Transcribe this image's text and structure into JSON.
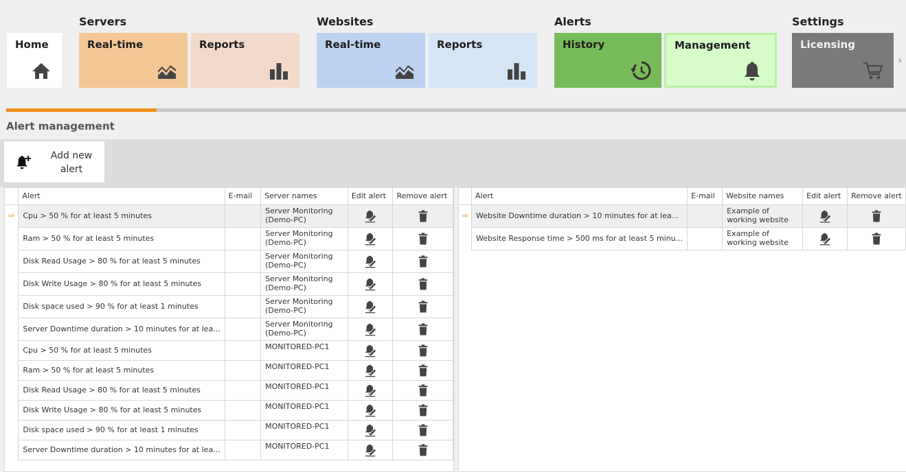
{
  "ribbon": {
    "groups": {
      "servers": "Servers",
      "websites": "Websites",
      "alerts": "Alerts",
      "settings": "Settings"
    },
    "tiles": {
      "home": "Home",
      "servers_realtime": "Real-time",
      "servers_reports": "Reports",
      "websites_realtime": "Real-time",
      "websites_reports": "Reports",
      "alerts_history": "History",
      "alerts_management": "Management",
      "settings_licensing": "Licensing"
    },
    "icons": {
      "home": "home-icon",
      "realtime": "realtime-chart-icon",
      "reports": "bar-chart-icon",
      "history": "history-icon",
      "management": "bell-icon",
      "licensing": "cart-icon"
    },
    "scroll_glyph": "›",
    "colors": {
      "servers_realtime": "#f3c896",
      "servers_reports": "#f2d9c9",
      "websites_realtime": "#bcd2f2",
      "websites_reports": "#d6e5f6",
      "history": "#78bb5a",
      "management": "#d6fcc8",
      "licensing": "#7a7a7a",
      "accent": "#ef8f1a"
    }
  },
  "page": {
    "title": "Alert management",
    "add_button": "Add new alert",
    "row_indicator": "⇨"
  },
  "server_grid": {
    "columns": [
      "Alert",
      "E-mail",
      "Server names",
      "Edit alert",
      "Remove alert"
    ],
    "rows": [
      {
        "alert": "Cpu > 50 % for at least 5 minutes",
        "email": "",
        "server": "Server Monitoring (Demo-PC)"
      },
      {
        "alert": "Ram > 50 % for at least 5 minutes",
        "email": "",
        "server": "Server Monitoring (Demo-PC)"
      },
      {
        "alert": "Disk Read Usage > 80 % for at least 5 minutes",
        "email": "",
        "server": "Server Monitoring (Demo-PC)"
      },
      {
        "alert": "Disk Write Usage > 80 % for at least 5 minutes",
        "email": "",
        "server": "Server Monitoring (Demo-PC)"
      },
      {
        "alert": "Disk space used > 90 % for at least 1 minutes",
        "email": "",
        "server": "Server Monitoring (Demo-PC)"
      },
      {
        "alert": "Server Downtime duration > 10 minutes for at lea...",
        "email": "",
        "server": "Server Monitoring (Demo-PC)"
      },
      {
        "alert": "Cpu > 50 % for at least 5 minutes",
        "email": "",
        "server": "MONITORED-PC1"
      },
      {
        "alert": "Ram > 50 % for at least 5 minutes",
        "email": "",
        "server": "MONITORED-PC1"
      },
      {
        "alert": "Disk Read Usage > 80 % for at least 5 minutes",
        "email": "",
        "server": "MONITORED-PC1"
      },
      {
        "alert": "Disk Write Usage > 80 % for at least 5 minutes",
        "email": "",
        "server": "MONITORED-PC1"
      },
      {
        "alert": "Disk space used > 90 % for at least 1 minutes",
        "email": "",
        "server": "MONITORED-PC1"
      },
      {
        "alert": "Server Downtime duration > 10 minutes for at lea...",
        "email": "",
        "server": "MONITORED-PC1"
      }
    ]
  },
  "website_grid": {
    "columns": [
      "Alert",
      "E-mail",
      "Website names",
      "Edit alert",
      "Remove alert"
    ],
    "rows": [
      {
        "alert": "Website Downtime duration > 10 minutes for at lea...",
        "email": "",
        "website": "Example of working website"
      },
      {
        "alert": "Website Response time > 500 ms for at least 5 minu...",
        "email": "",
        "website": "Example of working website"
      }
    ]
  }
}
